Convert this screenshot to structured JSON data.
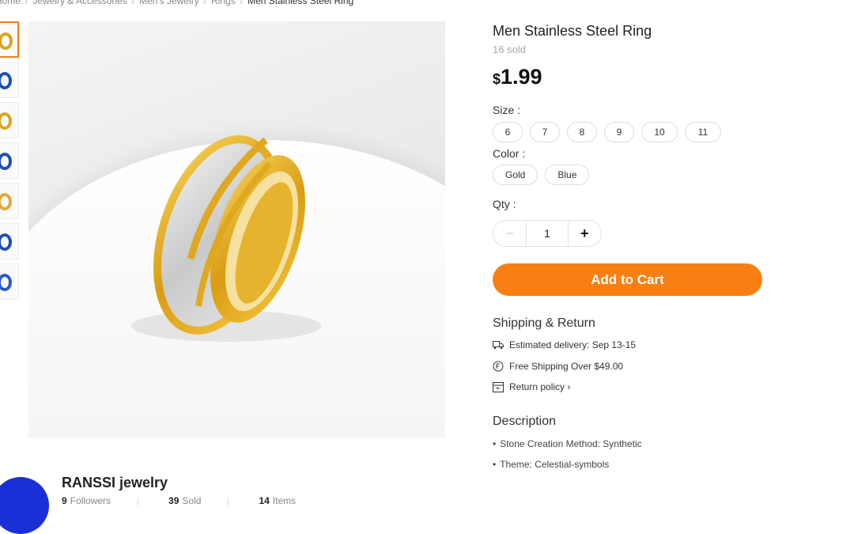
{
  "breadcrumb": {
    "items": [
      "Home",
      "Jewelry & Accessories",
      "Men's Jewelry",
      "Rings",
      "Men Stainless Steel Ring"
    ],
    "separator": "/"
  },
  "product": {
    "title": "Men Stainless Steel Ring",
    "sold": "16 sold",
    "currency": "$",
    "price": "1.99"
  },
  "size": {
    "label": "Size :",
    "options": [
      "6",
      "7",
      "8",
      "9",
      "10",
      "11"
    ]
  },
  "color": {
    "label": "Color :",
    "options": [
      "Gold",
      "Blue"
    ]
  },
  "qty": {
    "label": "Qty :",
    "value": "1",
    "minus": "−",
    "plus": "+"
  },
  "cart": {
    "label": "Add to Cart",
    "color": "#f97f12"
  },
  "shipping": {
    "heading": "Shipping & Return",
    "delivery": "Estimated delivery: Sep 13-15",
    "free": "Free Shipping Over $49.00",
    "return": "Return policy ›"
  },
  "description": {
    "heading": "Description",
    "items": [
      "Stone Creation Method: Synthetic",
      "Theme: Celestial-symbols"
    ]
  },
  "store": {
    "name": "RANSSI jewelry",
    "followers_num": "9",
    "followers_label": "Followers",
    "sold_num": "39",
    "sold_label": "Sold",
    "items_num": "14",
    "items_label": "Items"
  },
  "thumbnails": [
    "gold",
    "blue",
    "gold",
    "blue",
    "gold",
    "blue",
    "blue"
  ],
  "colors": {
    "accent": "#f97f12",
    "thumb_active_border": "#f57c1f"
  }
}
